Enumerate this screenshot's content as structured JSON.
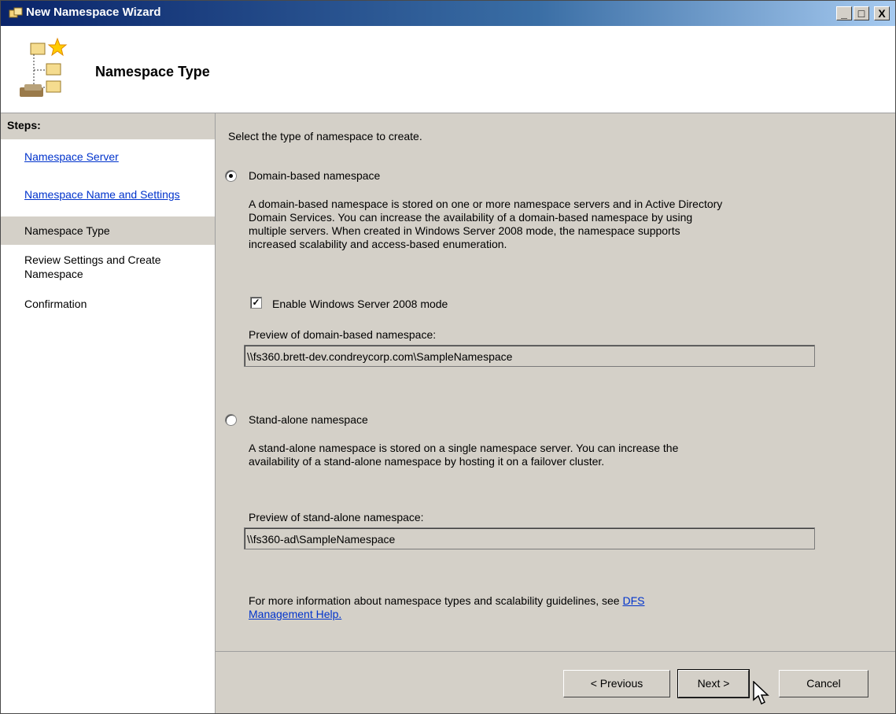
{
  "window": {
    "title": "New Namespace Wizard",
    "controls": [
      "_",
      "□",
      "X"
    ]
  },
  "header": {
    "title": "Namespace Type"
  },
  "sidebar": {
    "heading": "Steps:",
    "items": [
      {
        "label": "Namespace Server"
      },
      {
        "label": "Namespace Name and Settings"
      },
      {
        "label": "Namespace Type"
      },
      {
        "label_line1": "Review Settings and Create",
        "label_line2": "Namespace"
      },
      {
        "label": "Confirmation"
      }
    ]
  },
  "main": {
    "intro": "Select the type of namespace to create.",
    "domain": {
      "label": "Domain-based namespace",
      "selected": true,
      "desc_lines": [
        "A domain-based namespace is stored on one or more namespace servers and in Active Directory",
        "Domain Services. You can increase the availability of a domain-based namespace by using",
        "multiple servers. When created in Windows Server 2008 mode, the namespace supports",
        "increased scalability and access-based enumeration."
      ],
      "mode_label": "Enable Windows Server 2008 mode",
      "mode_checked": true,
      "preview_label": "Preview of domain-based namespace:",
      "preview_value": "\\\\fs360.brett-dev.condreycorp.com\\SampleNamespace"
    },
    "standalone": {
      "label": "Stand-alone namespace",
      "selected": false,
      "desc_lines": [
        "A stand-alone namespace is stored on a single namespace server. You can increase the",
        "availability of a stand-alone namespace by hosting it on a failover cluster."
      ],
      "preview_label": "Preview of stand-alone namespace:",
      "preview_value": "\\\\fs360-ad\\SampleNamespace"
    },
    "info_text": "For more information about namespace types and scalability guidelines, see ",
    "info_link_line1": "DFS",
    "info_link_line2": "Management Help."
  },
  "buttons": {
    "previous": "< Previous",
    "next": "Next >",
    "cancel": "Cancel"
  }
}
